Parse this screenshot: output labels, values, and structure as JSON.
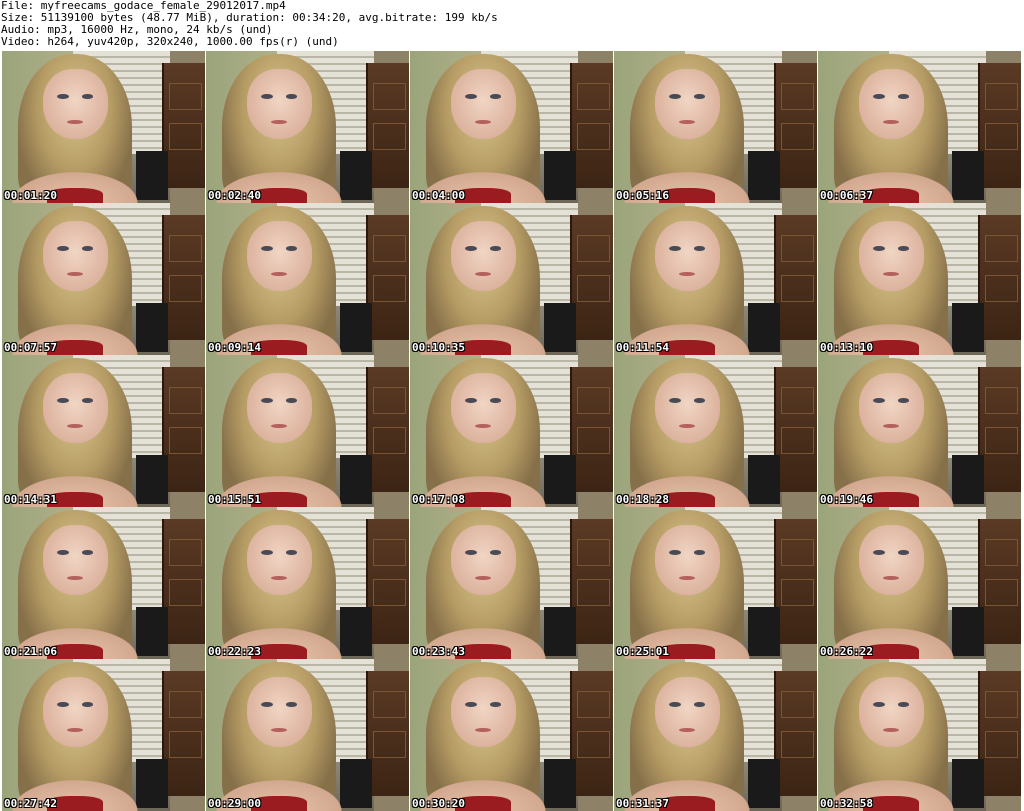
{
  "header": {
    "file": "File: myfreecams_godace_female_29012017.mp4",
    "size": "Size: 51139100 bytes (48.77 MiB), duration: 00:34:20, avg.bitrate: 199 kb/s",
    "audio": "Audio: mp3, 16000 Hz, mono, 24 kb/s (und)",
    "video": "Video: h264, yuv420p, 320x240, 1000.00 fps(r) (und)"
  },
  "thumbnails": [
    {
      "time": "00:01:20"
    },
    {
      "time": "00:02:40"
    },
    {
      "time": "00:04:00"
    },
    {
      "time": "00:05:16"
    },
    {
      "time": "00:06:37"
    },
    {
      "time": "00:07:57"
    },
    {
      "time": "00:09:14"
    },
    {
      "time": "00:10:35"
    },
    {
      "time": "00:11:54"
    },
    {
      "time": "00:13:10"
    },
    {
      "time": "00:14:31"
    },
    {
      "time": "00:15:51"
    },
    {
      "time": "00:17:08"
    },
    {
      "time": "00:18:28"
    },
    {
      "time": "00:19:46"
    },
    {
      "time": "00:21:06"
    },
    {
      "time": "00:22:23"
    },
    {
      "time": "00:23:43"
    },
    {
      "time": "00:25:01"
    },
    {
      "time": "00:26:22"
    },
    {
      "time": "00:27:42"
    },
    {
      "time": "00:29:00"
    },
    {
      "time": "00:30:20"
    },
    {
      "time": "00:31:37"
    },
    {
      "time": "00:32:58"
    }
  ]
}
